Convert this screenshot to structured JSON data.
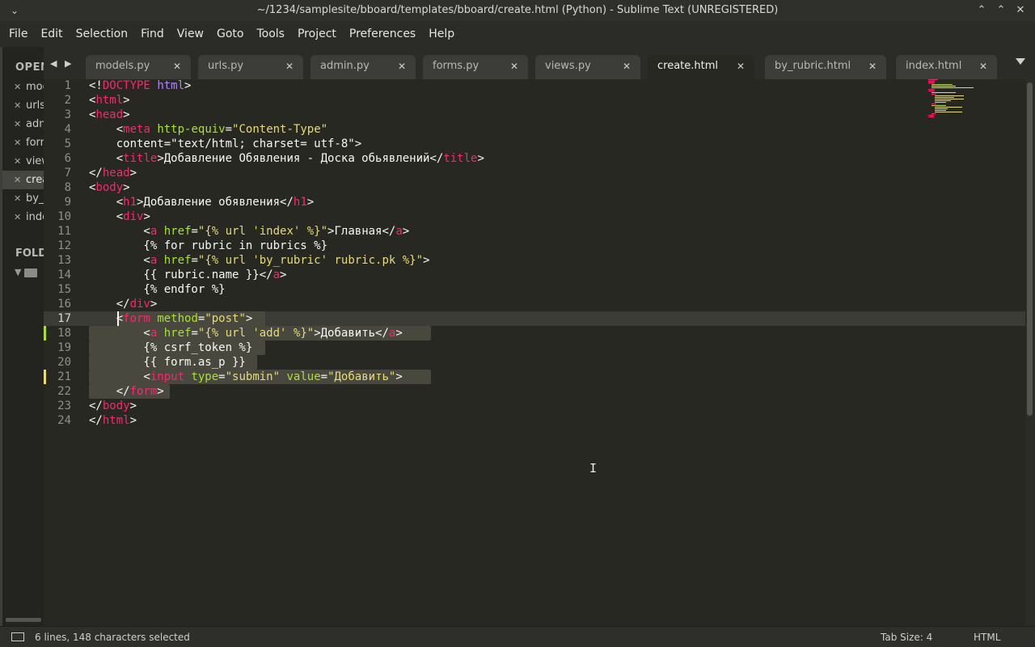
{
  "window": {
    "title": "~/1234/samplesite/bboard/templates/bboard/create.html (Python) - Sublime Text (UNREGISTERED)",
    "left_button": "⌄",
    "buttons": [
      "⌃",
      "⌃",
      "✕"
    ]
  },
  "menu": [
    "File",
    "Edit",
    "Selection",
    "Find",
    "View",
    "Goto",
    "Tools",
    "Project",
    "Preferences",
    "Help"
  ],
  "sidebar": {
    "open_files_header": "OPEN FILES",
    "open_files": [
      "models.py",
      "urls.py",
      "admin.py",
      "forms.py",
      "views.py",
      "create.html",
      "by_rubric.html",
      "index.html"
    ],
    "active_index": 5,
    "folders_header": "FOLDERS"
  },
  "tabs": {
    "nav": "◀ ▶",
    "items": [
      {
        "label": "models.py"
      },
      {
        "label": "urls.py"
      },
      {
        "label": "admin.py"
      },
      {
        "label": "forms.py"
      },
      {
        "label": "views.py"
      },
      {
        "label": "create.html",
        "active": true
      },
      {
        "label": "by_rubric.html"
      },
      {
        "label": "index.html"
      }
    ],
    "close_glyph": "✕"
  },
  "editor": {
    "line_numbers": [
      "1",
      "2",
      "3",
      "4",
      "5",
      "6",
      "7",
      "8",
      "9",
      "10",
      "11",
      "12",
      "13",
      "14",
      "15",
      "16",
      "17",
      "18",
      "19",
      "20",
      "21",
      "22",
      "23",
      "24"
    ],
    "current_line": 17,
    "lines": [
      "<!DOCTYPE html>",
      "<html>",
      "<head>",
      "    <meta http-equiv=\"Content-Type\"",
      "    content=\"text/html; charset= utf-8\">",
      "    <title>Добавление Обявления - Доска обьявлений</title>",
      "</head>",
      "<body>",
      "    <h1>Добавление обявления</h1>",
      "    <div>",
      "        <a href=\"{% url 'index' %}\">Главная</a>",
      "        {% for rubric in rubrics %}",
      "        <a href=\"{% url 'by_rubric' rubric.pk %}\">",
      "        {{ rubric.name }}</a>",
      "        {% endfor %}",
      "    </div>",
      "    <form method=\"post\">",
      "        <a href=\"{% url 'add' %}\">Добавить</a>",
      "        {% csrf_token %}",
      "        {{ form.as_p }}",
      "        <input type=\"submin\" value=\"Добавить\">",
      "    </form>",
      "</body>",
      "</html>"
    ]
  },
  "colors": {
    "tag": "#f92672",
    "attr": "#a6e22e",
    "string": "#e6db74",
    "keyword": "#ae81ff",
    "text": "#f8f8f2",
    "background": "#272822",
    "modified_green": "#a6e22e",
    "modified_yellow": "#e6db74"
  },
  "status": {
    "selection": "6 lines, 148 characters selected",
    "tab_size": "Tab Size: 4",
    "syntax": "HTML"
  }
}
